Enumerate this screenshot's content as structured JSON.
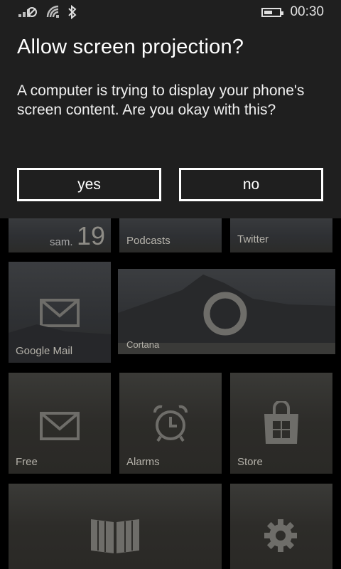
{
  "status_bar": {
    "time": "00:30",
    "icons": [
      "signal-off-icon",
      "wifi-icon",
      "bluetooth-icon",
      "battery-icon"
    ],
    "battery_level": 0.55
  },
  "dialog": {
    "title": "Allow screen projection?",
    "message": "A computer is trying to display your phone's screen content. Are you okay with this?",
    "yes_label": "yes",
    "no_label": "no"
  },
  "tiles": {
    "calendar": {
      "day": "sam.",
      "date": "19"
    },
    "podcasts": {
      "label": "Podcasts"
    },
    "twitter": {
      "label": "Twitter"
    },
    "google_mail": {
      "label": "Google Mail",
      "icon": "mail-icon"
    },
    "cortana": {
      "label": "Cortana",
      "icon": "cortana-icon"
    },
    "free": {
      "label": "Free",
      "icon": "mail-icon"
    },
    "alarms": {
      "label": "Alarms",
      "icon": "alarm-clock-icon"
    },
    "store": {
      "label": "Store",
      "icon": "store-icon"
    },
    "reading": {
      "icon": "book-icon"
    },
    "settings": {
      "icon": "gear-icon"
    }
  },
  "colors": {
    "dialog_bg": "#1f1f1f",
    "tile_bg": "#2b2a27",
    "label": "#b5b2aa"
  }
}
